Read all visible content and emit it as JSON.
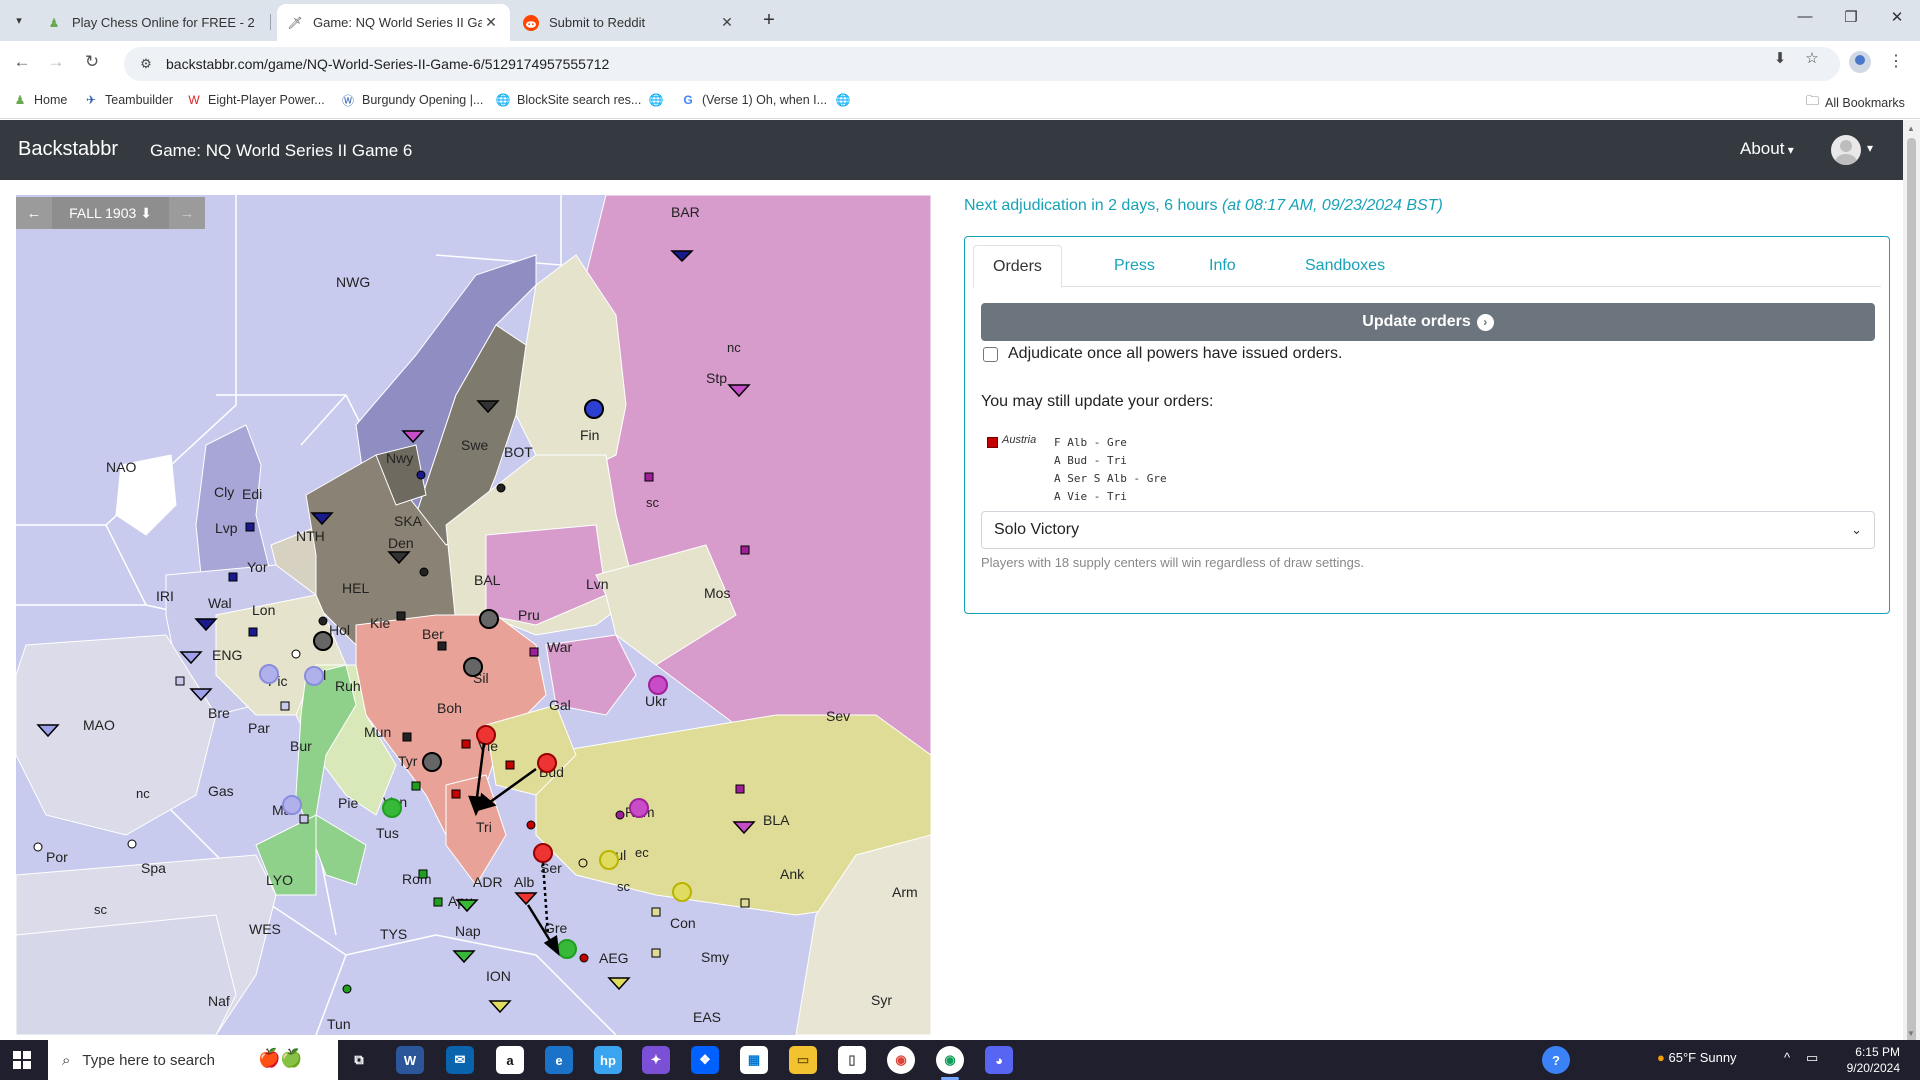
{
  "browser": {
    "tabs": [
      {
        "title": "Play Chess Online for FREE - 2 P",
        "icon": "chess-pawn-icon"
      },
      {
        "title": "Game: NQ World Series II Game",
        "icon": "backstabbr-knife-icon"
      },
      {
        "title": "Submit to Reddit",
        "icon": "reddit-icon"
      }
    ],
    "url": "backstabbr.com/game/NQ-World-Series-II-Game-6/5129174957555712",
    "bookmarks": [
      {
        "label": "Home"
      },
      {
        "label": "Teambuilder"
      },
      {
        "label": "Eight-Player Power..."
      },
      {
        "label": "Burgundy Opening |..."
      },
      {
        "label": "BlockSite search res..."
      },
      {
        "label": ""
      },
      {
        "label": "(Verse 1) Oh, when I..."
      },
      {
        "label": ""
      }
    ],
    "all_bookmarks": "All Bookmarks"
  },
  "site": {
    "brand": "Backstabbr",
    "game_title": "Game: NQ World Series II Game 6",
    "about": "About"
  },
  "map": {
    "phase": "FALL 1903",
    "phase_arrow": "⬇",
    "prev": "←",
    "next": "→",
    "labels": {
      "BAR": "BAR",
      "NWG": "NWG",
      "NAO": "NAO",
      "Fin": "Fin",
      "nc_stp": "nc",
      "Stp": "Stp",
      "Nwy": "Nwy",
      "Swe": "Swe",
      "BOT": "BOT",
      "sc_stp": "sc",
      "Cly": "Cly",
      "Edi": "Edi",
      "Lvp": "Lvp",
      "NTH": "NTH",
      "SKA": "SKA",
      "Den": "Den",
      "Yor": "Yor",
      "IRI": "IRI",
      "Wal": "Wal",
      "Lon": "Lon",
      "HEL": "HEL",
      "BAL": "BAL",
      "Lvn": "Lvn",
      "Mos": "Mos",
      "Hol": "Hol",
      "Kie": "Kie",
      "Ber": "Ber",
      "Pru": "Pru",
      "ENG": "ENG",
      "Pic": "Pic",
      "Bel": "Bel",
      "Ruh": "Ruh",
      "Sil": "Sil",
      "War": "War",
      "Bre": "Bre",
      "Par": "Par",
      "Boh": "Boh",
      "Gal": "Gal",
      "Ukr": "Ukr",
      "Sev": "Sev",
      "MAO": "MAO",
      "Bur": "Bur",
      "Mun": "Mun",
      "Vie": "Vie",
      "Tyr": "Tyr",
      "Bud": "Bud",
      "nc_spa": "nc",
      "Gas": "Gas",
      "Mar": "Mar",
      "Pie": "Pie",
      "Ven": "Ven",
      "Rum": "Rum",
      "BLA": "BLA",
      "Por": "Por",
      "Spa": "Spa",
      "Tri": "Tri",
      "Tus": "Tus",
      "Bul": "Bul",
      "ec": "ec",
      "LYO": "LYO",
      "Rom": "Rom",
      "ADR": "ADR",
      "Alb": "Alb",
      "Ser": "Ser",
      "sc_bul": "sc",
      "Ank": "Ank",
      "sc_spa": "sc",
      "Apu": "Apu",
      "Con": "Con",
      "Arm": "Arm",
      "WES": "WES",
      "TYS": "TYS",
      "Nap": "Nap",
      "Gre": "Gre",
      "AEG": "AEG",
      "Smy": "Smy",
      "ION": "ION",
      "Naf": "Naf",
      "Syr": "Syr",
      "Tun": "Tun",
      "EAS": "EAS"
    }
  },
  "panel": {
    "adjudication_prefix": "Next adjudication in 2 days, 6 hours ",
    "adjudication_time": "(at 08:17 AM, 09/23/2024 BST)",
    "tabs": [
      "Orders",
      "Press",
      "Info",
      "Sandboxes"
    ],
    "update_button": "Update orders",
    "adjudicate_checkbox": "Adjudicate once all powers have issued orders.",
    "adjudicate_checked": false,
    "may_update": "You may still update your orders:",
    "power": "Austria",
    "power_color": "#c40000",
    "orders": [
      "F Alb - Gre",
      "A Bud - Tri",
      "A Ser S Alb - Gre",
      "A Vie - Tri"
    ],
    "victory_select": "Solo Victory",
    "help": "Players with 18 supply centers will win regardless of draw settings."
  },
  "taskbar": {
    "search_placeholder": "Type here to search",
    "weather": "65°F  Sunny",
    "time": "6:15 PM",
    "date": "9/20/2024"
  },
  "colors": {
    "accent": "#17a2b8",
    "navbar": "#343a40",
    "austria": "#c40000",
    "england": "#1a1a8c",
    "france": "#8a8ce0",
    "germany": "#333333",
    "italy": "#1f9e1f",
    "russia": "#a0209a",
    "turkey": "#b8b400"
  }
}
